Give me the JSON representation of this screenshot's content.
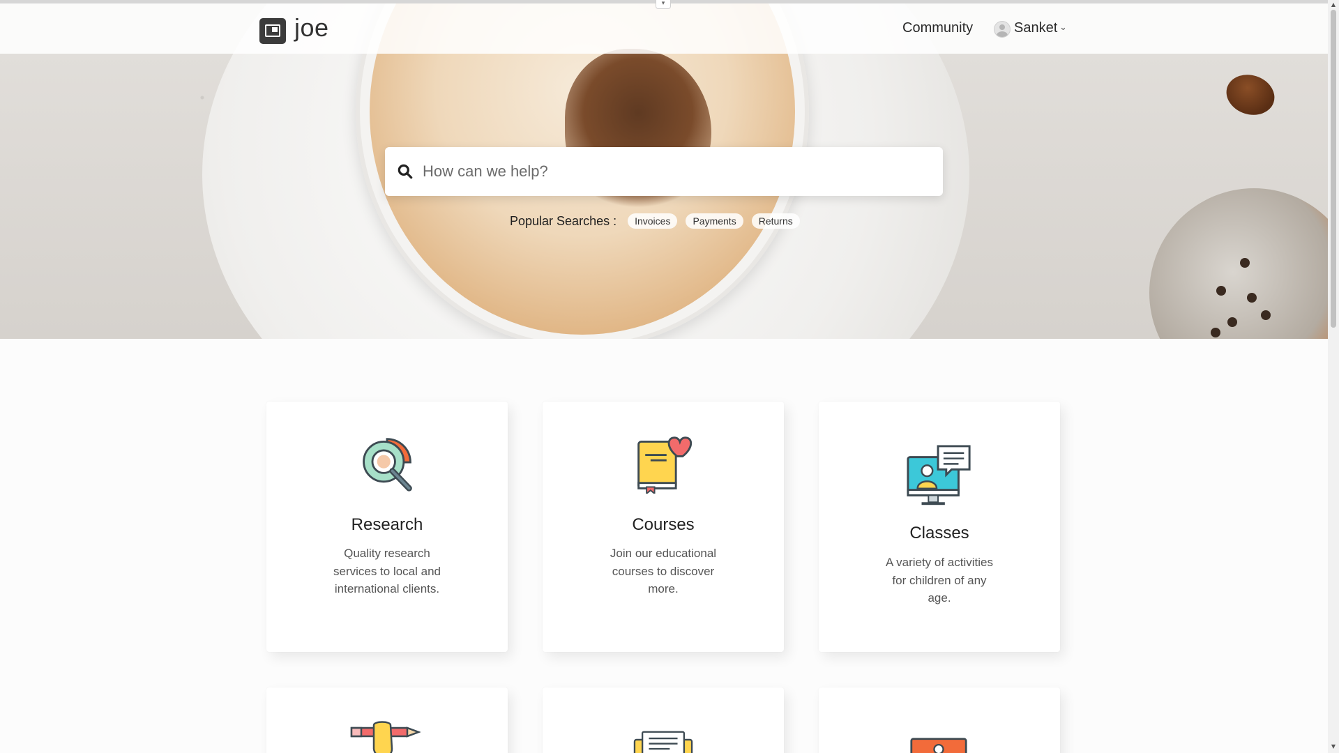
{
  "header": {
    "logo_text": "joe",
    "nav": {
      "community": "Community"
    },
    "user": {
      "name": "Sanket"
    }
  },
  "search": {
    "placeholder": "How can we help?",
    "popular_label": "Popular Searches :",
    "chips": [
      "Invoices",
      "Payments",
      "Returns"
    ]
  },
  "cards": [
    {
      "title": "Research",
      "description": "Quality research services to local and international clients.",
      "icon": "research-icon"
    },
    {
      "title": "Courses",
      "description": "Join our educational courses to discover more.",
      "icon": "book-heart-icon"
    },
    {
      "title": "Classes",
      "description": "A variety of activities for children of any age.",
      "icon": "monitor-chat-icon"
    },
    {
      "title": "",
      "description": "",
      "icon": "hand-pencil-icon"
    },
    {
      "title": "",
      "description": "",
      "icon": "document-icon"
    },
    {
      "title": "",
      "description": "",
      "icon": "monitor-icon"
    }
  ],
  "colors": {
    "accent_orange": "#f26b3a",
    "accent_yellow": "#ffd54f",
    "accent_teal": "#3cc8d9",
    "icon_dark": "#3d4a52"
  }
}
